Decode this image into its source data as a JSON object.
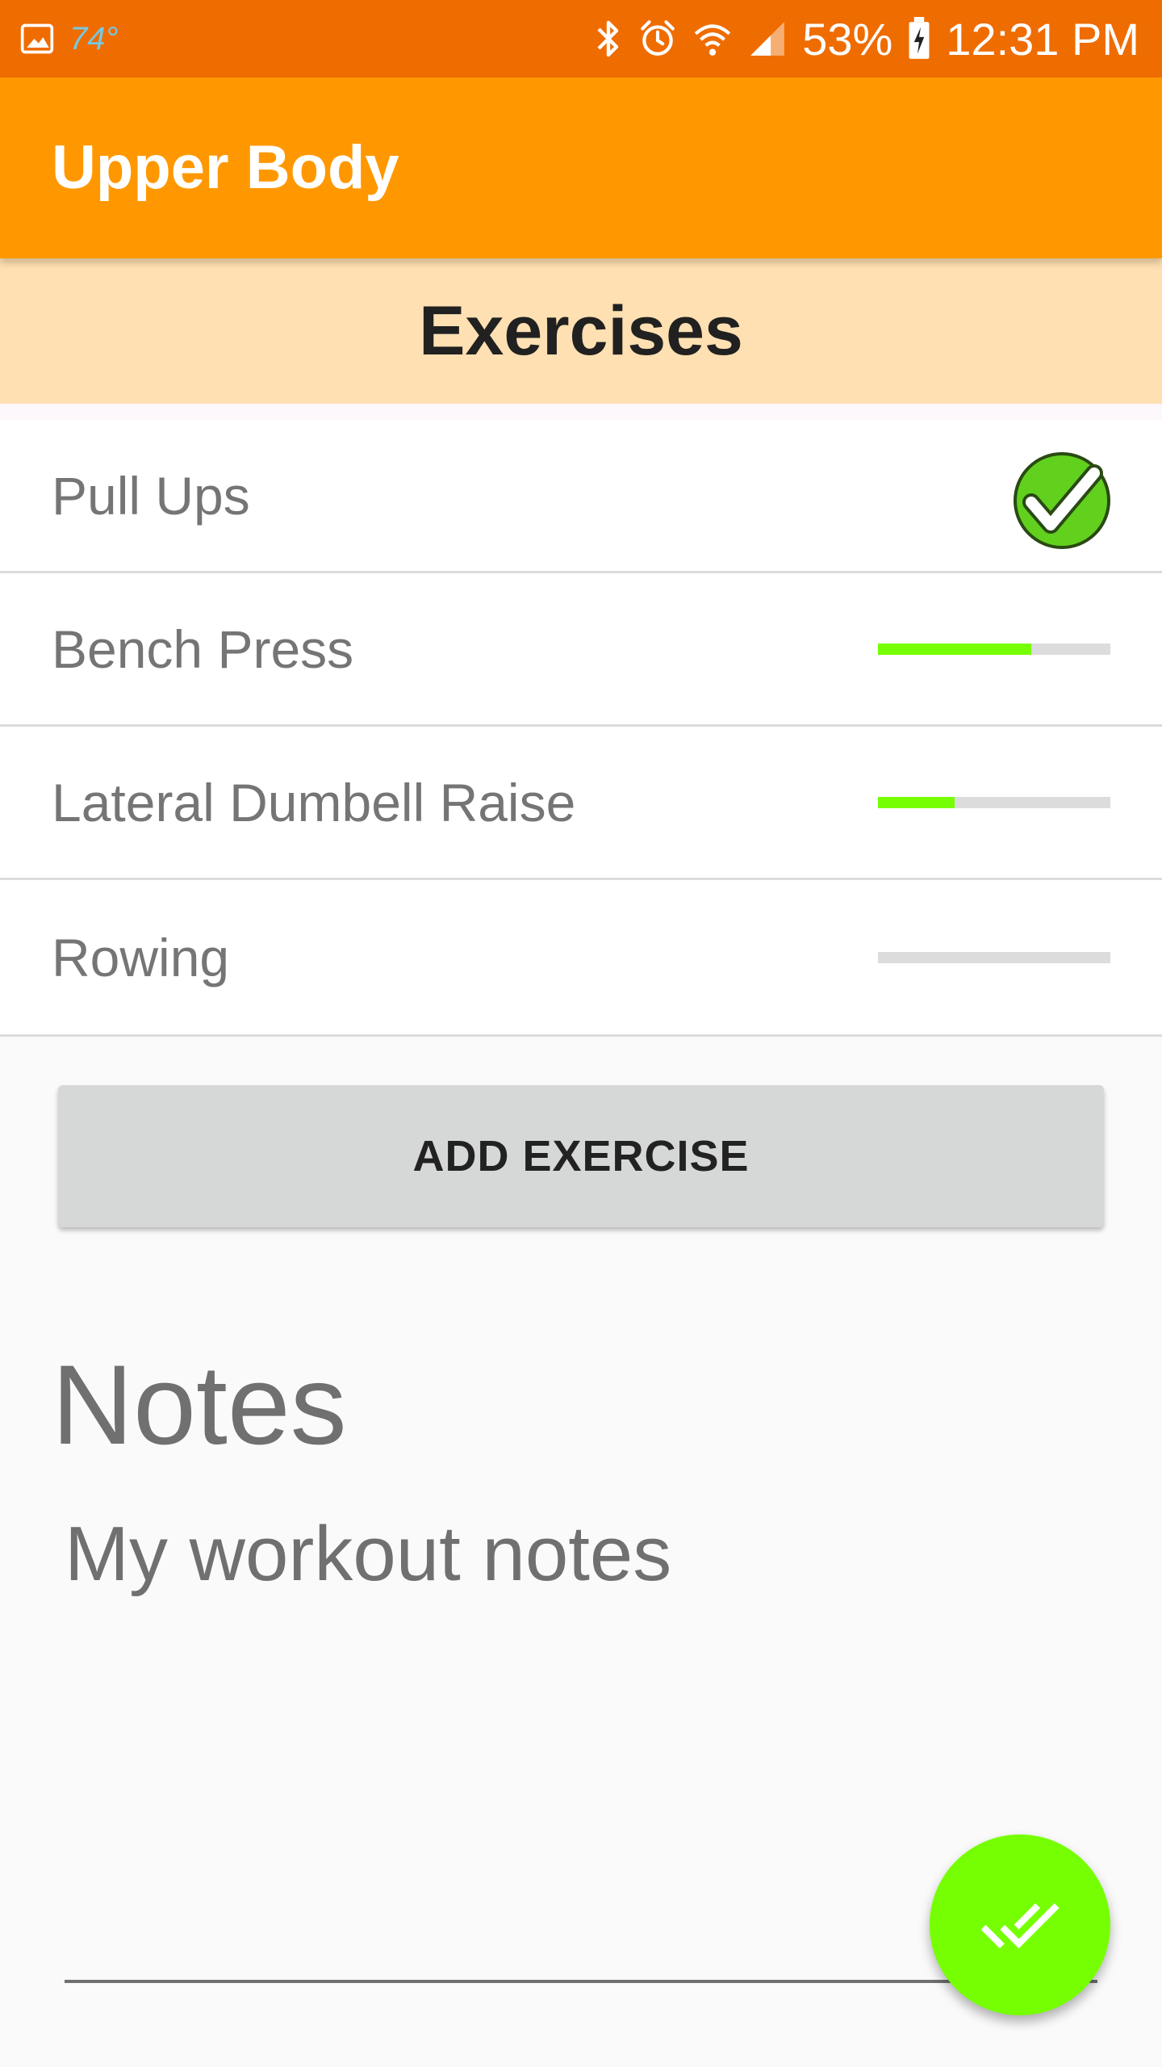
{
  "status_bar": {
    "temperature": "74°",
    "battery": "53%",
    "time": "12:31 PM",
    "icons": [
      "gallery-icon",
      "bluetooth-icon",
      "alarm-icon",
      "wifi-icon",
      "signal-icon",
      "battery-charging-icon"
    ]
  },
  "app_bar": {
    "title": "Upper Body",
    "background": "#ff9800"
  },
  "exercises_section": {
    "header": "Exercises",
    "items": [
      {
        "name": "Pull Ups",
        "completed": true,
        "progress": 1.0
      },
      {
        "name": "Bench Press",
        "completed": false,
        "progress": 0.66
      },
      {
        "name": "Lateral Dumbell Raise",
        "completed": false,
        "progress": 0.33
      },
      {
        "name": "Rowing",
        "completed": false,
        "progress": 0.0
      }
    ],
    "progress_color": "#76ff03"
  },
  "add_exercise_button": {
    "label": "ADD EXERCISE"
  },
  "notes": {
    "title": "Notes",
    "value": "My workout notes"
  },
  "fab": {
    "icon": "done-all-icon",
    "color": "#76ff03"
  }
}
